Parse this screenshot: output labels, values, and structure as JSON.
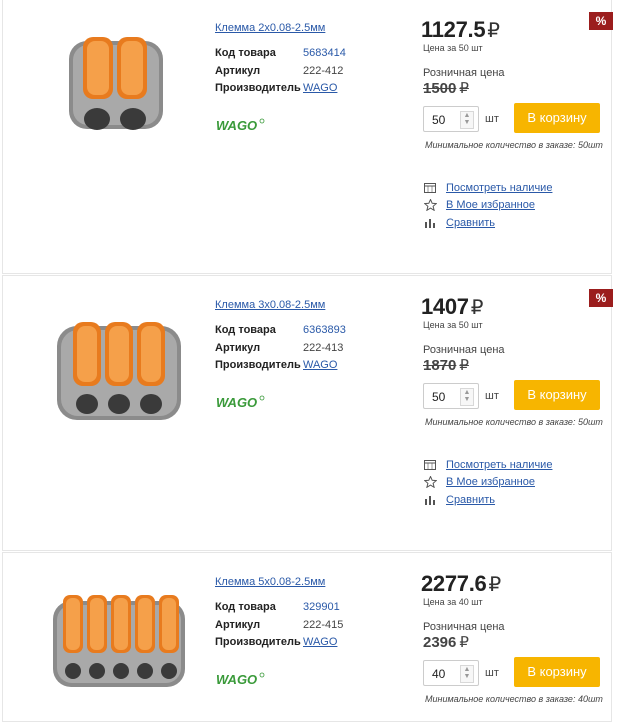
{
  "labels": {
    "code": "Код товара",
    "article": "Артикул",
    "manufacturer": "Производитель",
    "retail": "Розничная цена",
    "unit": "шт",
    "cart": "В корзину",
    "check_stock": "Посмотреть наличие",
    "favorite": "В Мое избранное",
    "compare": "Сравнить",
    "discount": "%",
    "currency": "₽",
    "brand_logo": "WAGO"
  },
  "products": [
    {
      "name": "Клемма 2х0.08-2.5мм",
      "code": "5683414",
      "article": "222-412",
      "manufacturer": "WAGO",
      "price": "1127.5",
      "price_note": "Цена за 50 шт",
      "old_price": "1500",
      "quantity": "50",
      "min_note": "Минимальное количество в заказе: 50шт",
      "levers": 2
    },
    {
      "name": "Клемма 3х0.08-2.5мм",
      "code": "6363893",
      "article": "222-413",
      "manufacturer": "WAGO",
      "price": "1407",
      "price_note": "Цена за 50 шт",
      "old_price": "1870",
      "quantity": "50",
      "min_note": "Минимальное количество в заказе: 50шт",
      "levers": 3
    },
    {
      "name": "Клемма 5х0.08-2.5мм",
      "code": "329901",
      "article": "222-415",
      "manufacturer": "WAGO",
      "price": "2277.6",
      "price_note": "Цена за 40 шт",
      "old_price": "2396",
      "quantity": "40",
      "min_note": "Минимальное количество в заказе: 40шт",
      "levers": 5
    }
  ],
  "colors": {
    "accent": "#f7b500",
    "link": "#2a59a8",
    "badge": "#9b1d1d",
    "wago_green": "#3a9a3a",
    "lever": "#f08a24"
  }
}
